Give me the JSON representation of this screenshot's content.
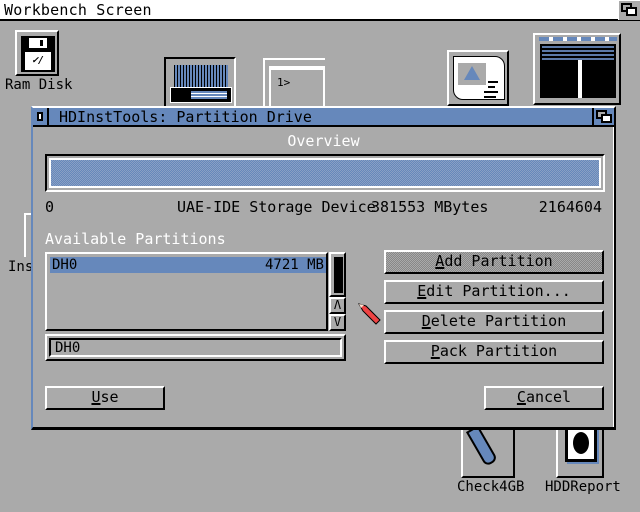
{
  "screen": {
    "title": "Workbench Screen"
  },
  "desktop_icons": [
    {
      "label": "Ram Disk",
      "icon": "floppy-disk-icon"
    },
    {
      "label": "",
      "icon": "tool-drawer-icon"
    },
    {
      "label": "",
      "icon": "shell-icon"
    },
    {
      "label": "",
      "icon": "prefs-icon"
    },
    {
      "label": "",
      "icon": "editor-icon"
    },
    {
      "label": "Ins",
      "icon": "install-icon"
    },
    {
      "label": "Check4GB",
      "icon": "check4gb-tool-icon"
    },
    {
      "label": "HDDReport",
      "icon": "hddreport-icon"
    }
  ],
  "window": {
    "title": "HDInstTools: Partition Drive",
    "overview": {
      "label": "Overview",
      "start": "0",
      "device_name": "UAE-IDE Storage Device",
      "capacity": "381553 MBytes",
      "end": "2164604"
    },
    "partitions": {
      "label": "Available Partitions",
      "items": [
        {
          "name": "DH0",
          "size": "4721 MB",
          "selected": true
        }
      ],
      "scroll_up": "Λ",
      "scroll_down": "V",
      "name_field_value": "DH0"
    },
    "buttons": {
      "add": {
        "hot": "A",
        "rest": "dd Partition",
        "disabled": true
      },
      "edit": {
        "hot": "E",
        "rest": "dit Partition..."
      },
      "delete": {
        "hot": "D",
        "rest": "elete Partition"
      },
      "pack": {
        "hot": "P",
        "rest": "ack Partition"
      },
      "use": {
        "hot": "U",
        "rest": "se"
      },
      "cancel": {
        "hot": "C",
        "rest": "ancel"
      }
    }
  },
  "colors": {
    "background": "#aaaaaa",
    "accent_blue": "#6688bb",
    "pointer": "#ee4444"
  }
}
